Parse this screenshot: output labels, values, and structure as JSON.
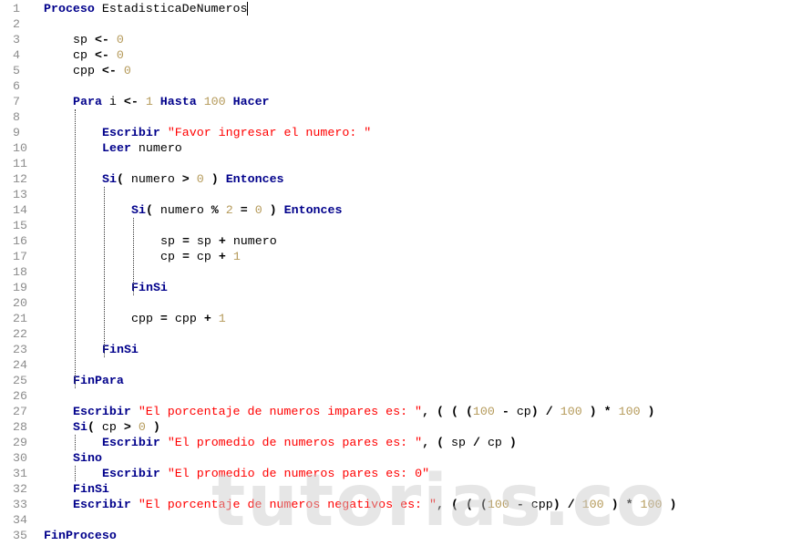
{
  "editor": {
    "language": "PSeInt",
    "lines": [
      {
        "n": "1",
        "indent": 0,
        "tokens": [
          [
            "kw",
            "Proceso"
          ],
          [
            "id",
            " EstadisticaDeNumeros"
          ]
        ]
      },
      {
        "n": "2",
        "indent": 0,
        "tokens": []
      },
      {
        "n": "3",
        "indent": 1,
        "tokens": [
          [
            "id",
            "sp "
          ],
          [
            "op",
            "<-"
          ],
          [
            "id",
            " "
          ],
          [
            "num",
            "0"
          ]
        ]
      },
      {
        "n": "4",
        "indent": 1,
        "tokens": [
          [
            "id",
            "cp "
          ],
          [
            "op",
            "<-"
          ],
          [
            "id",
            " "
          ],
          [
            "num",
            "0"
          ]
        ]
      },
      {
        "n": "5",
        "indent": 1,
        "tokens": [
          [
            "id",
            "cpp "
          ],
          [
            "op",
            "<-"
          ],
          [
            "id",
            " "
          ],
          [
            "num",
            "0"
          ]
        ]
      },
      {
        "n": "6",
        "indent": 0,
        "tokens": []
      },
      {
        "n": "7",
        "indent": 1,
        "tokens": [
          [
            "kw",
            "Para"
          ],
          [
            "id",
            " i "
          ],
          [
            "op",
            "<-"
          ],
          [
            "id",
            " "
          ],
          [
            "num",
            "1"
          ],
          [
            "id",
            " "
          ],
          [
            "kw",
            "Hasta"
          ],
          [
            "id",
            " "
          ],
          [
            "num",
            "100"
          ],
          [
            "id",
            " "
          ],
          [
            "kw",
            "Hacer"
          ]
        ]
      },
      {
        "n": "8",
        "indent": 0,
        "tokens": []
      },
      {
        "n": "9",
        "indent": 2,
        "tokens": [
          [
            "kw",
            "Escribir"
          ],
          [
            "id",
            " "
          ],
          [
            "str",
            "\"Favor ingresar el numero: \""
          ]
        ]
      },
      {
        "n": "10",
        "indent": 2,
        "tokens": [
          [
            "kw",
            "Leer"
          ],
          [
            "id",
            " numero"
          ]
        ]
      },
      {
        "n": "11",
        "indent": 0,
        "tokens": []
      },
      {
        "n": "12",
        "indent": 2,
        "tokens": [
          [
            "kw",
            "Si"
          ],
          [
            "op",
            "("
          ],
          [
            "id",
            " numero "
          ],
          [
            "op",
            ">"
          ],
          [
            "id",
            " "
          ],
          [
            "num",
            "0"
          ],
          [
            "id",
            " "
          ],
          [
            "op",
            ")"
          ],
          [
            "id",
            " "
          ],
          [
            "kw",
            "Entonces"
          ]
        ]
      },
      {
        "n": "13",
        "indent": 0,
        "tokens": []
      },
      {
        "n": "14",
        "indent": 3,
        "tokens": [
          [
            "kw",
            "Si"
          ],
          [
            "op",
            "("
          ],
          [
            "id",
            " numero "
          ],
          [
            "op",
            "%"
          ],
          [
            "id",
            " "
          ],
          [
            "num",
            "2"
          ],
          [
            "id",
            " "
          ],
          [
            "op",
            "="
          ],
          [
            "id",
            " "
          ],
          [
            "num",
            "0"
          ],
          [
            "id",
            " "
          ],
          [
            "op",
            ")"
          ],
          [
            "id",
            " "
          ],
          [
            "kw",
            "Entonces"
          ]
        ]
      },
      {
        "n": "15",
        "indent": 0,
        "tokens": []
      },
      {
        "n": "16",
        "indent": 4,
        "tokens": [
          [
            "id",
            "sp "
          ],
          [
            "op",
            "="
          ],
          [
            "id",
            " sp "
          ],
          [
            "op",
            "+"
          ],
          [
            "id",
            " numero"
          ]
        ]
      },
      {
        "n": "17",
        "indent": 4,
        "tokens": [
          [
            "id",
            "cp "
          ],
          [
            "op",
            "="
          ],
          [
            "id",
            " cp "
          ],
          [
            "op",
            "+"
          ],
          [
            "id",
            " "
          ],
          [
            "num",
            "1"
          ]
        ]
      },
      {
        "n": "18",
        "indent": 0,
        "tokens": []
      },
      {
        "n": "19",
        "indent": 3,
        "tokens": [
          [
            "kw",
            "FinSi"
          ]
        ]
      },
      {
        "n": "20",
        "indent": 0,
        "tokens": []
      },
      {
        "n": "21",
        "indent": 3,
        "tokens": [
          [
            "id",
            "cpp "
          ],
          [
            "op",
            "="
          ],
          [
            "id",
            " cpp "
          ],
          [
            "op",
            "+"
          ],
          [
            "id",
            " "
          ],
          [
            "num",
            "1"
          ]
        ]
      },
      {
        "n": "22",
        "indent": 0,
        "tokens": []
      },
      {
        "n": "23",
        "indent": 2,
        "tokens": [
          [
            "kw",
            "FinSi"
          ]
        ]
      },
      {
        "n": "24",
        "indent": 0,
        "tokens": []
      },
      {
        "n": "25",
        "indent": 1,
        "tokens": [
          [
            "kw",
            "FinPara"
          ]
        ]
      },
      {
        "n": "26",
        "indent": 0,
        "tokens": []
      },
      {
        "n": "27",
        "indent": 1,
        "tokens": [
          [
            "kw",
            "Escribir"
          ],
          [
            "id",
            " "
          ],
          [
            "str",
            "\"El porcentaje de numeros impares es: \""
          ],
          [
            "op",
            ","
          ],
          [
            "id",
            " "
          ],
          [
            "op",
            "("
          ],
          [
            "id",
            " "
          ],
          [
            "op",
            "("
          ],
          [
            "id",
            " "
          ],
          [
            "op",
            "("
          ],
          [
            "num",
            "100"
          ],
          [
            "id",
            " "
          ],
          [
            "op",
            "-"
          ],
          [
            "id",
            " cp"
          ],
          [
            "op",
            ")"
          ],
          [
            "id",
            " "
          ],
          [
            "op",
            "/"
          ],
          [
            "id",
            " "
          ],
          [
            "num",
            "100"
          ],
          [
            "id",
            " "
          ],
          [
            "op",
            ")"
          ],
          [
            "id",
            " "
          ],
          [
            "op",
            "*"
          ],
          [
            "id",
            " "
          ],
          [
            "num",
            "100"
          ],
          [
            "id",
            " "
          ],
          [
            "op",
            ")"
          ]
        ]
      },
      {
        "n": "28",
        "indent": 1,
        "tokens": [
          [
            "kw",
            "Si"
          ],
          [
            "op",
            "("
          ],
          [
            "id",
            " cp "
          ],
          [
            "op",
            ">"
          ],
          [
            "id",
            " "
          ],
          [
            "num",
            "0"
          ],
          [
            "id",
            " "
          ],
          [
            "op",
            ")"
          ]
        ]
      },
      {
        "n": "29",
        "indent": 2,
        "tokens": [
          [
            "kw",
            "Escribir"
          ],
          [
            "id",
            " "
          ],
          [
            "str",
            "\"El promedio de numeros pares es: \""
          ],
          [
            "op",
            ","
          ],
          [
            "id",
            " "
          ],
          [
            "op",
            "("
          ],
          [
            "id",
            " sp "
          ],
          [
            "op",
            "/"
          ],
          [
            "id",
            " cp "
          ],
          [
            "op",
            ")"
          ]
        ]
      },
      {
        "n": "30",
        "indent": 1,
        "tokens": [
          [
            "kw",
            "Sino"
          ]
        ]
      },
      {
        "n": "31",
        "indent": 2,
        "tokens": [
          [
            "kw",
            "Escribir"
          ],
          [
            "id",
            " "
          ],
          [
            "str",
            "\"El promedio de numeros pares es: 0\""
          ]
        ]
      },
      {
        "n": "32",
        "indent": 1,
        "tokens": [
          [
            "kw",
            "FinSi"
          ]
        ]
      },
      {
        "n": "33",
        "indent": 1,
        "tokens": [
          [
            "kw",
            "Escribir"
          ],
          [
            "id",
            " "
          ],
          [
            "str",
            "\"El porcentaje de numeros negativos es: \""
          ],
          [
            "op",
            ","
          ],
          [
            "id",
            " "
          ],
          [
            "op",
            "("
          ],
          [
            "id",
            " "
          ],
          [
            "op",
            "("
          ],
          [
            "id",
            " "
          ],
          [
            "op",
            "("
          ],
          [
            "num",
            "100"
          ],
          [
            "id",
            " "
          ],
          [
            "op",
            "-"
          ],
          [
            "id",
            " cpp"
          ],
          [
            "op",
            ")"
          ],
          [
            "id",
            " "
          ],
          [
            "op",
            "/"
          ],
          [
            "id",
            " "
          ],
          [
            "num",
            "100"
          ],
          [
            "id",
            " "
          ],
          [
            "op",
            ")"
          ],
          [
            "id",
            " "
          ],
          [
            "op",
            "*"
          ],
          [
            "id",
            " "
          ],
          [
            "num",
            "100"
          ],
          [
            "id",
            " "
          ],
          [
            "op",
            ")"
          ]
        ]
      },
      {
        "n": "34",
        "indent": 0,
        "tokens": []
      },
      {
        "n": "35",
        "indent": 0,
        "tokens": [
          [
            "kw",
            "FinProceso"
          ]
        ]
      }
    ]
  },
  "watermark": "tutorias.co"
}
